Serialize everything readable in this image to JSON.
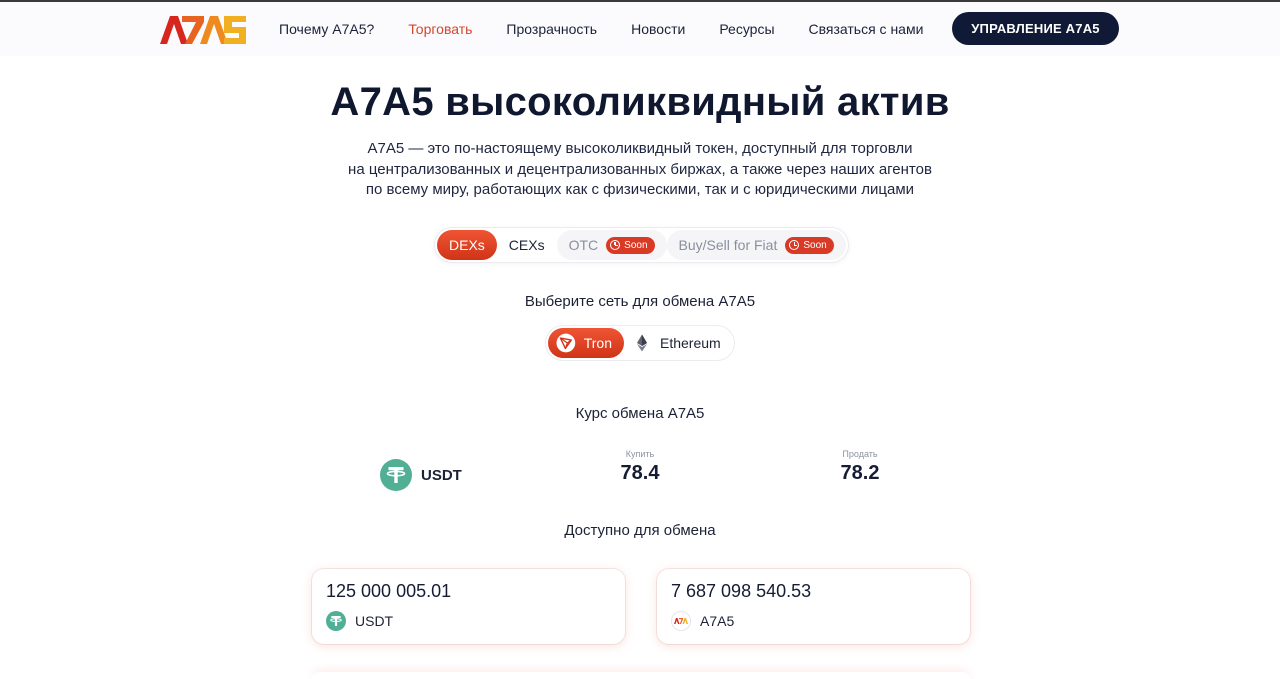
{
  "header": {
    "logo_text": "A7A5",
    "nav": [
      {
        "label": "Почему A7A5?",
        "active": false
      },
      {
        "label": "Торговать",
        "active": true
      },
      {
        "label": "Прозрачность",
        "active": false
      },
      {
        "label": "Новости",
        "active": false
      },
      {
        "label": "Ресурсы",
        "active": false
      },
      {
        "label": "Связаться с нами",
        "active": false
      }
    ],
    "cta_label": "УПРАВЛЕНИЕ A7A5"
  },
  "hero": {
    "title": "A7A5 высоколиквидный актив",
    "description_lines": [
      "A7A5 — это по-настоящему высоколиквидный токен, доступный для торговли",
      "на централизованных и децентрализованных биржах, а также через наших агентов",
      "по всему миру, работающих как с физическими, так и с юридическими лицами"
    ]
  },
  "tabs": [
    {
      "label": "DEXs",
      "state": "active"
    },
    {
      "label": "CEXs",
      "state": "normal"
    },
    {
      "label": "OTC",
      "state": "disabled",
      "badge": "Soon"
    },
    {
      "label": "Buy/Sell for Fiat",
      "state": "disabled",
      "badge": "Soon"
    }
  ],
  "network": {
    "label": "Выберите сеть для обмена A7A5",
    "options": [
      {
        "label": "Tron",
        "icon": "tron-icon",
        "active": true
      },
      {
        "label": "Ethereum",
        "icon": "ethereum-icon",
        "active": false
      }
    ]
  },
  "rate": {
    "title": "Курс обмена A7A5",
    "asset": "USDT",
    "buy_label": "Купить",
    "buy_value": "78.4",
    "sell_label": "Продать",
    "sell_value": "78.2"
  },
  "available": {
    "title": "Доступно для обмена",
    "cards": [
      {
        "amount": "125 000 005.01",
        "currency": "USDT",
        "icon": "usdt-icon"
      },
      {
        "amount": "7 687 098 540.53",
        "currency": "A7A5",
        "icon": "a7a5-icon"
      }
    ]
  },
  "colors": {
    "accent": "#e0452b",
    "dark": "#101a36",
    "usdt": "#50af95",
    "logo_red": "#d7261e",
    "logo_gold": "#f0b021"
  }
}
